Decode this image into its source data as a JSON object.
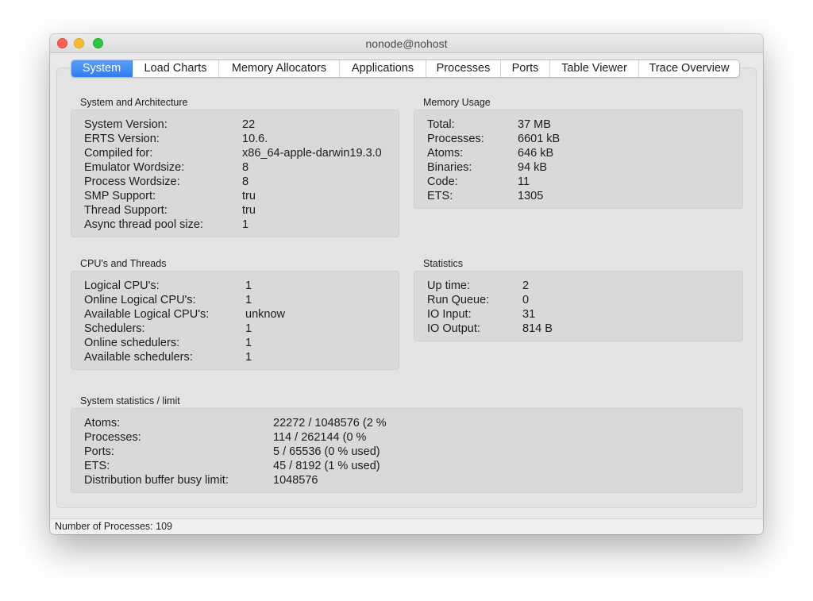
{
  "window": {
    "title": "nonode@nohost"
  },
  "tabs": [
    {
      "label": "System"
    },
    {
      "label": "Load Charts"
    },
    {
      "label": "Memory Allocators"
    },
    {
      "label": "Applications"
    },
    {
      "label": "Processes"
    },
    {
      "label": "Ports"
    },
    {
      "label": "Table Viewer"
    },
    {
      "label": "Trace Overview"
    }
  ],
  "system_arch": {
    "title": "System and Architecture",
    "rows": [
      {
        "label": "System Version:",
        "value": "22"
      },
      {
        "label": "ERTS Version:",
        "value": "10.6."
      },
      {
        "label": "Compiled for:",
        "value": "x86_64-apple-darwin19.3.0"
      },
      {
        "label": "Emulator Wordsize:",
        "value": "8"
      },
      {
        "label": "Process Wordsize:",
        "value": "8"
      },
      {
        "label": "SMP Support:",
        "value": "tru"
      },
      {
        "label": "Thread Support:",
        "value": "tru"
      },
      {
        "label": "Async thread pool size:",
        "value": "1"
      }
    ]
  },
  "memory": {
    "title": "Memory Usage",
    "rows": [
      {
        "label": "Total:",
        "value": "37 MB"
      },
      {
        "label": "Processes:",
        "value": "6601 kB"
      },
      {
        "label": "Atoms:",
        "value": "646 kB"
      },
      {
        "label": "Binaries:",
        "value": "94 kB"
      },
      {
        "label": "Code:",
        "value": "11"
      },
      {
        "label": "ETS:",
        "value": "1305"
      }
    ]
  },
  "cpus": {
    "title": "CPU's and Threads",
    "rows": [
      {
        "label": "Logical CPU's:",
        "value": "1"
      },
      {
        "label": "Online Logical CPU's:",
        "value": "1"
      },
      {
        "label": "Available Logical CPU's:",
        "value": "unknow"
      },
      {
        "label": "Schedulers:",
        "value": "1"
      },
      {
        "label": "Online schedulers:",
        "value": "1"
      },
      {
        "label": "Available schedulers:",
        "value": "1"
      }
    ]
  },
  "statistics": {
    "title": "Statistics",
    "rows": [
      {
        "label": "Up time:",
        "value": "2"
      },
      {
        "label": "Run Queue:",
        "value": "0"
      },
      {
        "label": "IO Input:",
        "value": "31"
      },
      {
        "label": "IO Output:",
        "value": "814 B"
      }
    ]
  },
  "limits": {
    "title": "System statistics / limit",
    "rows": [
      {
        "label": "Atoms:",
        "value": "22272 / 1048576 (2 %"
      },
      {
        "label": "Processes:",
        "value": "114 / 262144 (0 %"
      },
      {
        "label": "Ports:",
        "value": "5 / 65536 (0 % used)"
      },
      {
        "label": "ETS:",
        "value": "45 / 8192 (1 % used)"
      },
      {
        "label": "Distribution buffer busy limit:",
        "value": "1048576"
      }
    ]
  },
  "status": {
    "text": "Number of Processes: 109"
  }
}
